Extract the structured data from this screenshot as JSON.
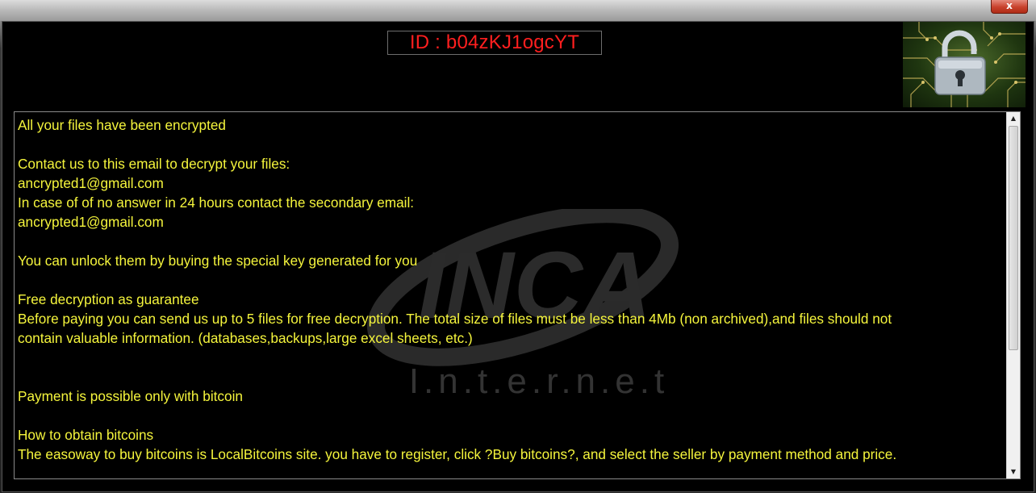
{
  "window": {
    "close_glyph": "x"
  },
  "header": {
    "id_text": "ID : b04zKJ1ogcYT",
    "id_color": "#ff1f1f",
    "lock_icon": "padlock-circuit-image"
  },
  "watermark": {
    "logo_text": "INCA",
    "sub_text": "I.n.t.e.r.n.e.t"
  },
  "note": {
    "text_color": "#f5f53c",
    "lines": [
      "All your files have been encrypted",
      "",
      "Contact us to this email to decrypt your files:",
      "ancrypted1@gmail.com",
      "In case of of no answer in 24 hours contact the secondary email:",
      "ancrypted1@gmail.com",
      "",
      "You can unlock them by buying the special key generated for you",
      "",
      "Free decryption as guarantee",
      "Before paying you can send us up to 5 files for free decryption. The total size of files must be less than 4Mb (non archived),and files should not",
      "contain valuable information. (databases,backups,large excel sheets, etc.)",
      "",
      "",
      "Payment is possible only with bitcoin",
      "",
      "How to obtain bitcoins",
      "The easoway to buy bitcoins is LocalBitcoins site. you have to register, click ?Buy bitcoins?, and select the seller by payment method and price."
    ]
  },
  "scrollbar": {
    "up_glyph": "▲",
    "down_glyph": "▼"
  }
}
